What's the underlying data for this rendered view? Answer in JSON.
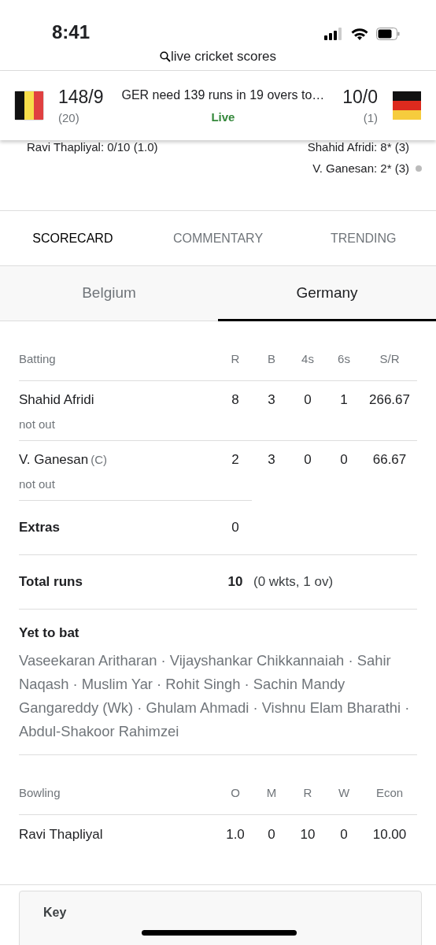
{
  "status_bar": {
    "time": "8:41"
  },
  "search": {
    "query": "live cricket scores"
  },
  "match": {
    "home": {
      "score": "148/9",
      "overs": "(20)"
    },
    "away": {
      "score": "10/0",
      "overs": "(1)"
    },
    "summary": "GER need 139 runs in 19 overs to…",
    "status": "Live"
  },
  "current_players": {
    "bowler": "Ravi Thapliyal: 0/10 (1.0)",
    "batters": [
      {
        "text": "Shahid Afridi: 8* (3)",
        "on_strike": false
      },
      {
        "text": "V. Ganesan: 2* (3)",
        "on_strike": true
      }
    ]
  },
  "tabs": [
    {
      "label": "SCORECARD",
      "selected": true
    },
    {
      "label": "COMMENTARY",
      "selected": false
    },
    {
      "label": "TRENDING",
      "selected": false
    }
  ],
  "team_tabs": [
    {
      "label": "Belgium",
      "selected": false
    },
    {
      "label": "Germany",
      "selected": true
    }
  ],
  "batting": {
    "columns": [
      "Batting",
      "R",
      "B",
      "4s",
      "6s",
      "S/R"
    ],
    "rows": [
      {
        "cells": [
          "Shahid Afridi",
          "8",
          "3",
          "0",
          "1",
          "266.67"
        ],
        "role": "",
        "dismissal": "not out"
      },
      {
        "cells": [
          "V. Ganesan",
          "2",
          "3",
          "0",
          "0",
          "66.67"
        ],
        "role": "(C)",
        "dismissal": "not out"
      }
    ],
    "extras": {
      "label": "Extras",
      "value": "0"
    },
    "total": {
      "label": "Total runs",
      "value": "10",
      "detail": "(0 wkts, 1 ov)"
    }
  },
  "yet_to_bat": {
    "title": "Yet to bat",
    "players": "Vaseekaran Aritharan · Vijayshankar Chikkannaiah · Sahir Naqash · Muslim Yar · Rohit Singh · Sachin Mandy Gangareddy (Wk) · Ghulam Ahmadi · Vishnu Elam Bharathi · Abdul-Shakoor Rahimzei"
  },
  "bowling": {
    "columns": [
      "Bowling",
      "O",
      "M",
      "R",
      "W",
      "Econ"
    ],
    "rows": [
      {
        "cells": [
          "Ravi Thapliyal",
          "1.0",
          "0",
          "10",
          "0",
          "10.00"
        ]
      }
    ]
  },
  "key": {
    "title": "Key"
  }
}
